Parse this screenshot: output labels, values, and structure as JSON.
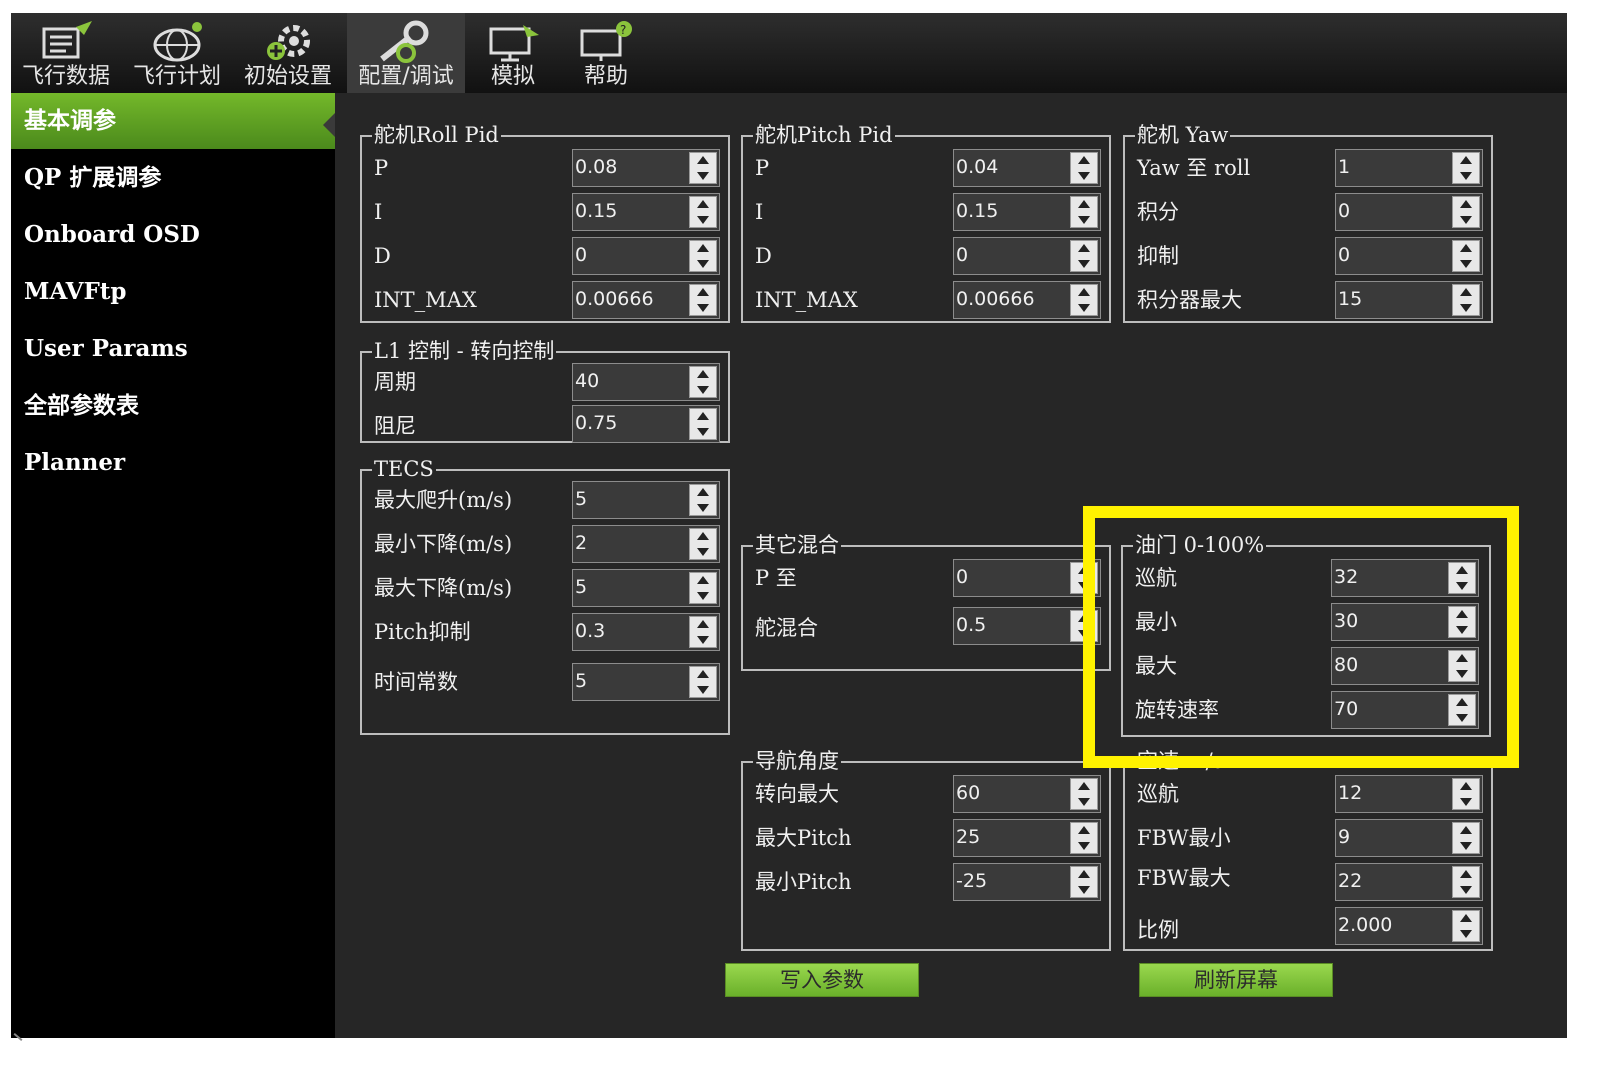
{
  "toolbar": {
    "items": [
      {
        "label": "飞行数据",
        "icon": "flight-data-icon"
      },
      {
        "label": "飞行计划",
        "icon": "flight-plan-icon"
      },
      {
        "label": "初始设置",
        "icon": "initial-setup-icon"
      },
      {
        "label": "配置/调试",
        "icon": "config-tuning-icon",
        "active": true
      },
      {
        "label": "模拟",
        "icon": "simulation-icon"
      },
      {
        "label": "帮助",
        "icon": "help-icon"
      }
    ]
  },
  "sidebar": {
    "items": [
      {
        "label": "基本调参",
        "active": true
      },
      {
        "label": "QP 扩展调参"
      },
      {
        "label": "Onboard OSD"
      },
      {
        "label": "MAVFtp"
      },
      {
        "label": "User Params"
      },
      {
        "label": "全部参数表"
      },
      {
        "label": "Planner"
      }
    ]
  },
  "groups": {
    "roll_pid": {
      "title": "舵机Roll Pid",
      "params": [
        {
          "label": "P",
          "value": "0.08"
        },
        {
          "label": "I",
          "value": "0.15"
        },
        {
          "label": "D",
          "value": "0"
        },
        {
          "label": "INT_MAX",
          "value": "0.00666"
        }
      ]
    },
    "pitch_pid": {
      "title": "舵机Pitch Pid",
      "params": [
        {
          "label": "P",
          "value": "0.04"
        },
        {
          "label": "I",
          "value": "0.15"
        },
        {
          "label": "D",
          "value": "0"
        },
        {
          "label": "INT_MAX",
          "value": "0.00666"
        }
      ]
    },
    "yaw": {
      "title": "舵机 Yaw",
      "params": [
        {
          "label": "Yaw 至 roll",
          "value": "1"
        },
        {
          "label": "积分",
          "value": "0"
        },
        {
          "label": "抑制",
          "value": "0"
        },
        {
          "label": "积分器最大",
          "value": "15"
        }
      ]
    },
    "l1": {
      "title": "L1 控制 - 转向控制",
      "params": [
        {
          "label": "周期",
          "value": "40"
        },
        {
          "label": "阻尼",
          "value": "0.75"
        }
      ]
    },
    "tecs": {
      "title": "TECS",
      "params": [
        {
          "label": "最大爬升(m/s)",
          "value": "5"
        },
        {
          "label": "最小下降(m/s)",
          "value": "2"
        },
        {
          "label": "最大下降(m/s)",
          "value": "5"
        },
        {
          "label": "Pitch抑制",
          "value": "0.3"
        },
        {
          "label": "时间常数",
          "value": "5"
        }
      ]
    },
    "other_mix": {
      "title": "其它混合",
      "params": [
        {
          "label": "P 至",
          "value": "0"
        },
        {
          "label": "舵混合",
          "value": "0.5"
        }
      ]
    },
    "throttle": {
      "title": "油门 0-100%",
      "params": [
        {
          "label": "巡航",
          "value": "32"
        },
        {
          "label": "最小",
          "value": "30"
        },
        {
          "label": "最大",
          "value": "80"
        },
        {
          "label": "旋转速率",
          "value": "70"
        }
      ]
    },
    "nav_angle": {
      "title": "导航角度",
      "params": [
        {
          "label": "转向最大",
          "value": "60"
        },
        {
          "label": "最大Pitch",
          "value": "25"
        },
        {
          "label": "最小Pitch",
          "value": "-25"
        }
      ]
    },
    "airspeed": {
      "title": "空速 m/s",
      "params": [
        {
          "label": "巡航",
          "value": "12"
        },
        {
          "label": "FBW最小",
          "value": "9"
        },
        {
          "label": "FBW最大",
          "value": "22"
        },
        {
          "label": "比例",
          "value": "2.000"
        }
      ]
    }
  },
  "buttons": {
    "write_params": "写入参数",
    "refresh_screen": "刷新屏幕"
  },
  "colors": {
    "accent_green": "#74b82a",
    "highlight": "#fff200",
    "panel_bg": "#262626"
  }
}
